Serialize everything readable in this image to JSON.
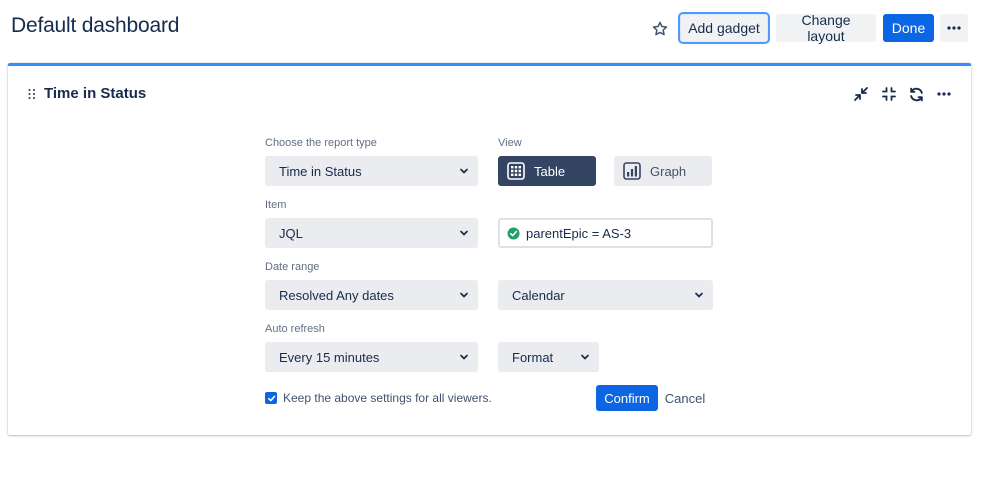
{
  "header": {
    "title": "Default dashboard",
    "star_icon": "star-icon",
    "add_gadget_label": "Add gadget",
    "change_layout_label": "Change layout",
    "done_label": "Done",
    "more_label": "•••"
  },
  "gadget": {
    "title": "Time in Status",
    "actions": [
      "minimize-icon",
      "collapse-icon",
      "refresh-icon",
      "more-icon"
    ],
    "more_label": "•••",
    "accent_color": "#388bff"
  },
  "form": {
    "report_type": {
      "label": "Choose the report type",
      "value": "Time in Status"
    },
    "view": {
      "label": "View",
      "table_label": "Table",
      "graph_label": "Graph",
      "selected": "Table"
    },
    "item": {
      "label": "Item",
      "value": "JQL",
      "jql_value": "parentEpic = AS-3",
      "jql_valid": true
    },
    "date_range": {
      "label": "Date range",
      "value": "Resolved Any dates",
      "calendar_value": "Calendar"
    },
    "auto_refresh": {
      "label": "Auto refresh",
      "value": "Every 15 minutes",
      "format_value": "Format"
    },
    "keep_settings": {
      "label": "Keep the above settings for all viewers.",
      "checked": true
    },
    "confirm_label": "Confirm",
    "cancel_label": "Cancel"
  },
  "colors": {
    "primary": "#0c66e4",
    "selected_view": "#344563",
    "valid_check": "#22a06b"
  }
}
